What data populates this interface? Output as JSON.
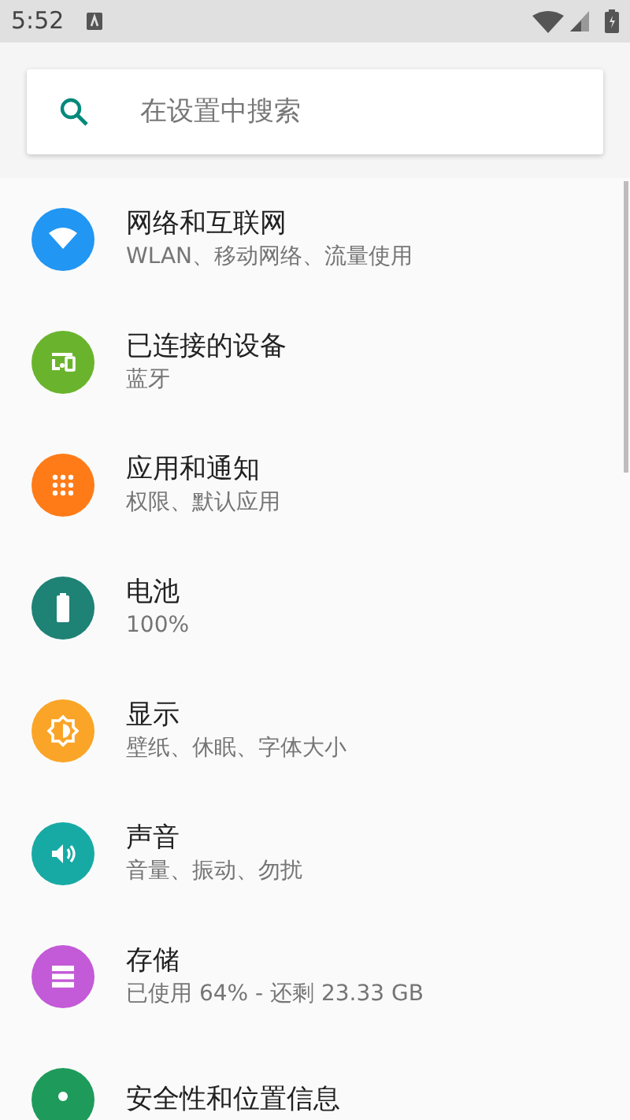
{
  "status_bar": {
    "time": "5:52"
  },
  "search": {
    "placeholder": "在设置中搜索"
  },
  "items": [
    {
      "title": "网络和互联网",
      "subtitle": "WLAN、移动网络、流量使用",
      "color": "#2196f3"
    },
    {
      "title": "已连接的设备",
      "subtitle": "蓝牙",
      "color": "#6ab42d"
    },
    {
      "title": "应用和通知",
      "subtitle": "权限、默认应用",
      "color": "#ff7b17"
    },
    {
      "title": "电池",
      "subtitle": "100%",
      "color": "#1e8275"
    },
    {
      "title": "显示",
      "subtitle": "壁纸、休眠、字体大小",
      "color": "#faa527"
    },
    {
      "title": "声音",
      "subtitle": "音量、振动、勿扰",
      "color": "#17aaa5"
    },
    {
      "title": "存储",
      "subtitle": "已使用 64% - 还剩 23.33 GB",
      "color": "#c35ad7"
    },
    {
      "title": "安全性和位置信息",
      "color": "#1e9b5a"
    }
  ]
}
